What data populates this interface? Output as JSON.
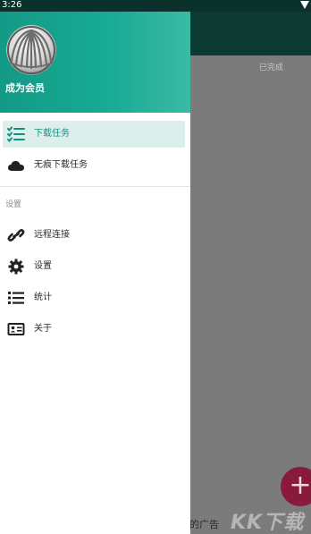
{
  "status_bar": {
    "time": "3:26"
  },
  "background": {
    "tab_label": "已完成",
    "bottom_text": "的广告",
    "watermark": "KK下载",
    "fab_icon": "plus-icon"
  },
  "drawer": {
    "header_title": "成为会员",
    "menu": [
      {
        "label": "下载任务",
        "icon": "checklist-icon",
        "active": true
      },
      {
        "label": "无痕下载任务",
        "icon": "cloud-icon",
        "active": false
      }
    ],
    "settings_section": {
      "title": "设置",
      "items": [
        {
          "label": "远程连接",
          "icon": "link-icon"
        },
        {
          "label": "设置",
          "icon": "gear-icon"
        },
        {
          "label": "统计",
          "icon": "list-icon"
        },
        {
          "label": "关于",
          "icon": "id-card-icon"
        }
      ]
    }
  },
  "colors": {
    "accent": "#16907e",
    "header_gradient_start": "#139a86",
    "header_gradient_end": "#3bbaa5",
    "active_item_bg": "#dcefec",
    "fab": "#8a1a3c"
  }
}
